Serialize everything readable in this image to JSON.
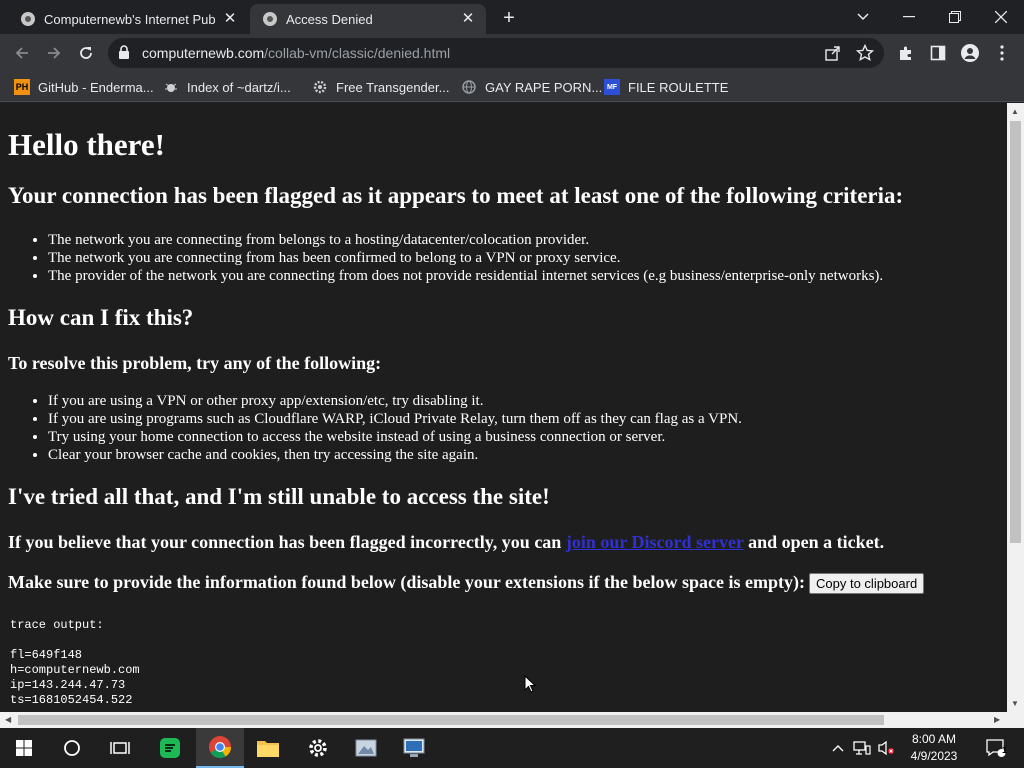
{
  "browser": {
    "tabs": [
      {
        "title": "Computernewb's Internet Pub",
        "active": false
      },
      {
        "title": "Access Denied",
        "active": true
      }
    ],
    "url_host": "computernewb.com",
    "url_path": "/collab-vm/classic/denied.html",
    "bookmarks": [
      {
        "label": "GitHub - Enderma...",
        "icon": "ph-icon"
      },
      {
        "label": "Index of ~dartz/i...",
        "icon": "bug-icon"
      },
      {
        "label": "Free Transgender...",
        "icon": "gear-icon"
      },
      {
        "label": "GAY RAPE PORN...",
        "icon": "globe-icon"
      },
      {
        "label": "FILE ROULETTE",
        "icon": "mf-icon"
      }
    ]
  },
  "page": {
    "h1": "Hello there!",
    "flagged_heading": "Your connection has been flagged as it appears to meet at least one of the following criteria:",
    "criteria": [
      "The network you are connecting from belongs to a hosting/datacenter/colocation provider.",
      "The network you are connecting from has been confirmed to belong to a VPN or proxy service.",
      "The provider of the network you are connecting from does not provide residential internet services (e.g business/enterprise-only networks)."
    ],
    "fix_heading": "How can I fix this?",
    "resolve_heading": "To resolve this problem, try any of the following:",
    "fixes": [
      "If you are using a VPN or other proxy app/extension/etc, try disabling it.",
      "If you are using programs such as Cloudflare WARP, iCloud Private Relay, turn them off as they can flag as a VPN.",
      "Try using your home connection to access the website instead of using a business connection or server.",
      "Clear your browser cache and cookies, then try accessing the site again."
    ],
    "tried_heading": "I've tried all that, and I'm still unable to access the site!",
    "incorrect_before": "If you believe that your connection has been flagged incorrectly, you can ",
    "incorrect_link": "join our Discord server",
    "incorrect_after": " and open a ticket.",
    "info_text": "Make sure to provide the information found below (disable your extensions if the below space is empty):",
    "copy_button": "Copy to clipboard",
    "trace_label": "trace output:",
    "trace_lines": [
      "fl=649f148",
      "h=computernewb.com",
      "ip=143.244.47.73",
      "ts=1681052454.522"
    ]
  },
  "taskbar": {
    "time": "8:00 AM",
    "date": "4/9/2023",
    "notification_count": "1"
  }
}
